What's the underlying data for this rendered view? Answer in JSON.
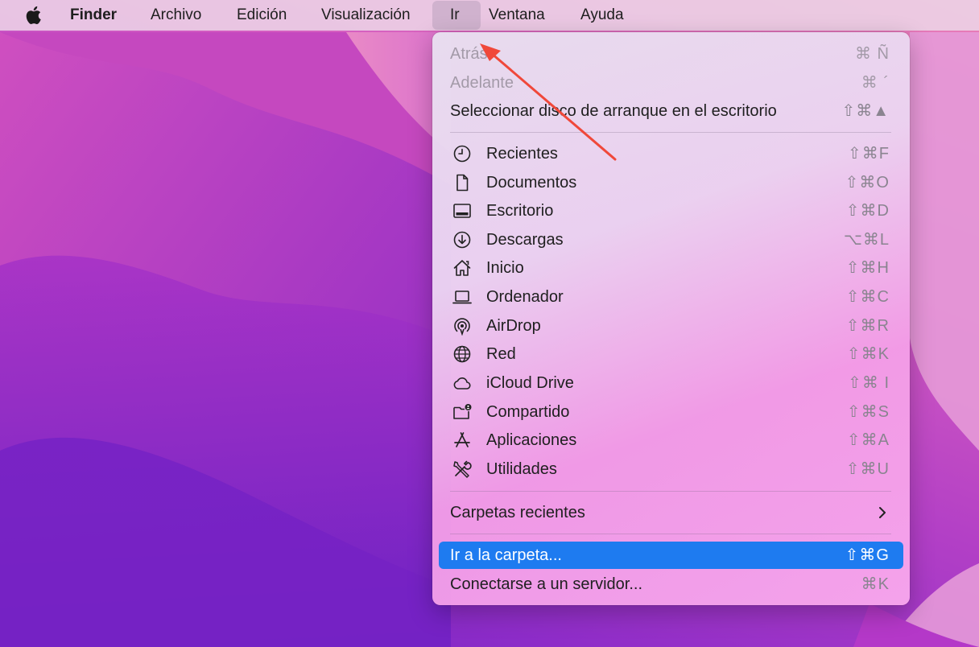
{
  "menubar": {
    "app_name": "Finder",
    "items": [
      "Archivo",
      "Edición",
      "Visualización",
      "Ir",
      "Ventana",
      "Ayuda"
    ]
  },
  "menu": {
    "top_items": [
      {
        "label": "Atrás",
        "shortcut": "⌘ Ñ",
        "disabled": true
      },
      {
        "label": "Adelante",
        "shortcut": "⌘ ´",
        "disabled": true
      },
      {
        "label": "Seleccionar disco de arranque en el escritorio",
        "shortcut": "⇧⌘▲",
        "disabled": false
      }
    ],
    "places": [
      {
        "icon": "clock-icon",
        "label": "Recientes",
        "shortcut": "⇧⌘F"
      },
      {
        "icon": "document-icon",
        "label": "Documentos",
        "shortcut": "⇧⌘O"
      },
      {
        "icon": "desktop-icon",
        "label": "Escritorio",
        "shortcut": "⇧⌘D"
      },
      {
        "icon": "download-icon",
        "label": "Descargas",
        "shortcut": "⌥⌘L"
      },
      {
        "icon": "home-icon",
        "label": "Inicio",
        "shortcut": "⇧⌘H"
      },
      {
        "icon": "laptop-icon",
        "label": "Ordenador",
        "shortcut": "⇧⌘C"
      },
      {
        "icon": "airdrop-icon",
        "label": "AirDrop",
        "shortcut": "⇧⌘R"
      },
      {
        "icon": "globe-icon",
        "label": "Red",
        "shortcut": "⇧⌘K"
      },
      {
        "icon": "cloud-icon",
        "label": "iCloud Drive",
        "shortcut": "⇧⌘ I"
      },
      {
        "icon": "shared-folder-icon",
        "label": "Compartido",
        "shortcut": "⇧⌘S"
      },
      {
        "icon": "applications-icon",
        "label": "Aplicaciones",
        "shortcut": "⇧⌘A"
      },
      {
        "icon": "tools-icon",
        "label": "Utilidades",
        "shortcut": "⇧⌘U"
      }
    ],
    "recent_folders": {
      "label": "Carpetas recientes"
    },
    "goto_folder": {
      "label": "Ir a la carpeta...",
      "shortcut": "⇧⌘G"
    },
    "connect_server": {
      "label": "Conectarse a un servidor...",
      "shortcut": "⌘K"
    }
  },
  "colors": {
    "highlight": "#1e7bf0",
    "annotation_arrow": "#f0483a"
  }
}
